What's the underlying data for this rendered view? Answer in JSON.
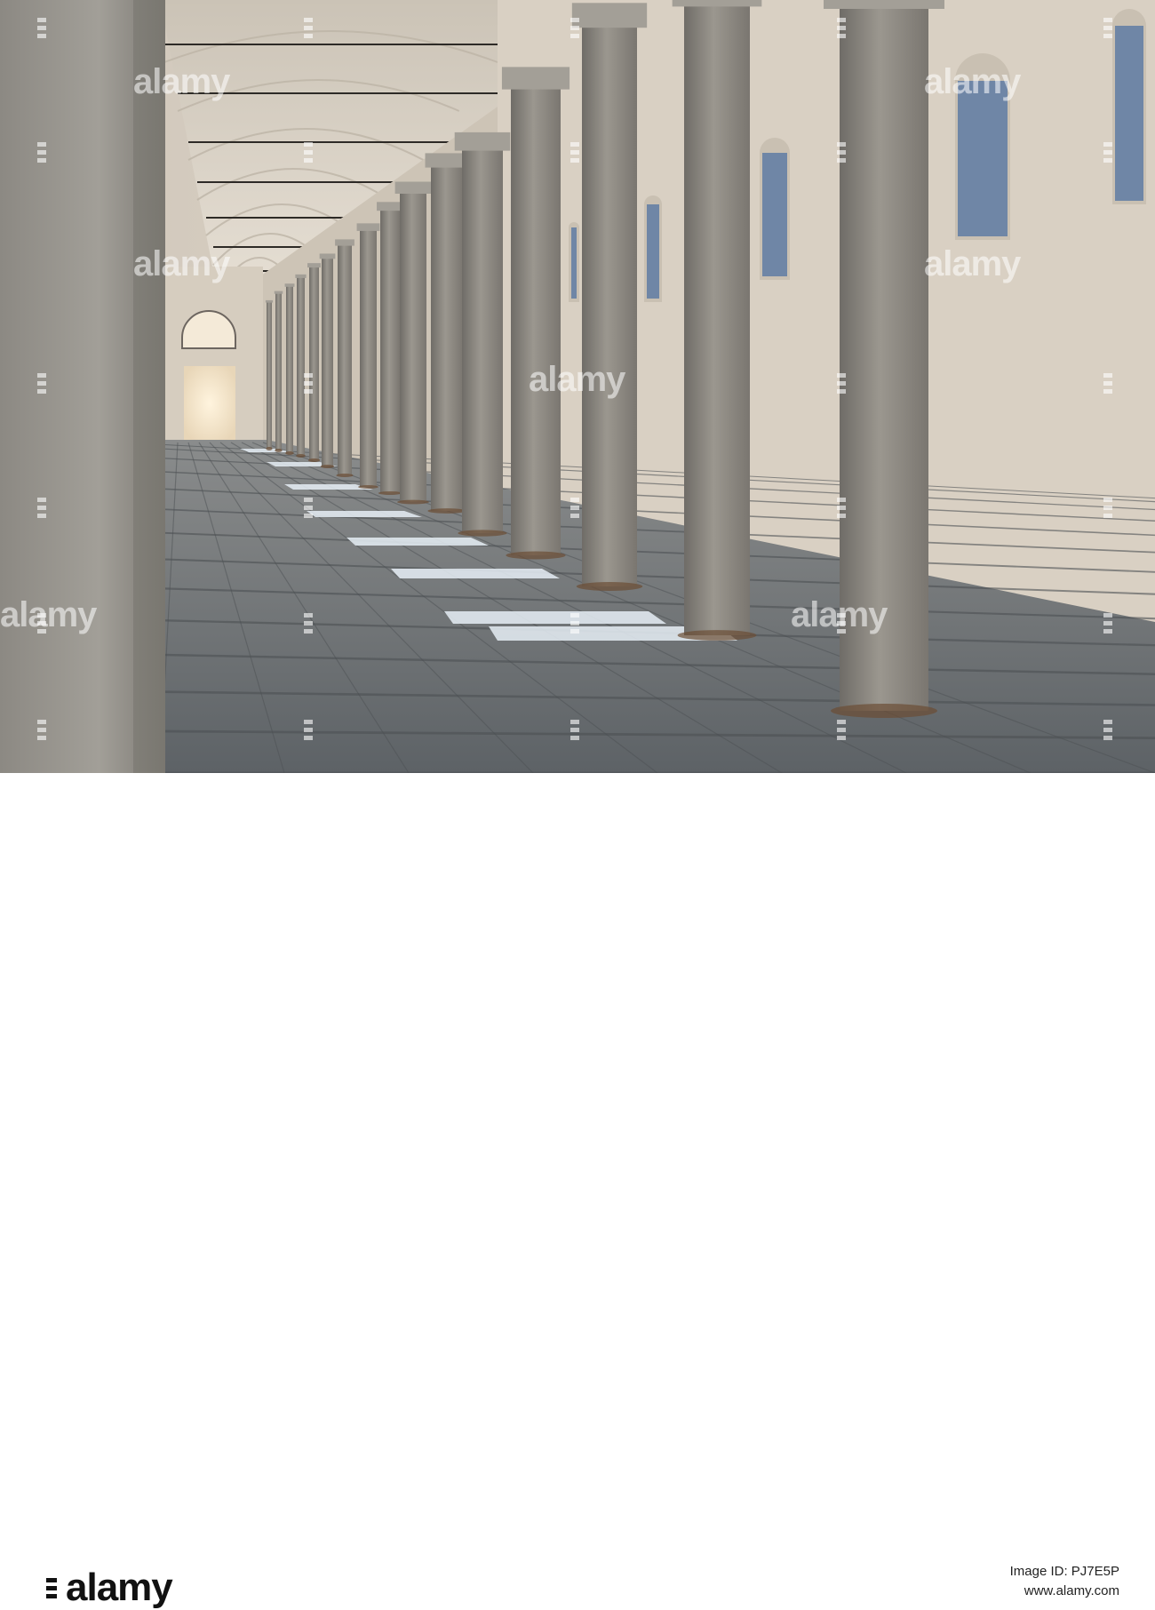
{
  "photo": {
    "subject": "colonnade-hall",
    "colors": {
      "wall": "#d8d0c4",
      "vault": "#e2dbd0",
      "column": "#8f8c86",
      "floor": "#6f7478",
      "light": "#dfe8f0"
    }
  },
  "watermark": {
    "text": "alamy"
  },
  "footer": {
    "brand": "alamy",
    "image_id": "Image ID: PJ7E5P",
    "site": "www.alamy.com"
  }
}
